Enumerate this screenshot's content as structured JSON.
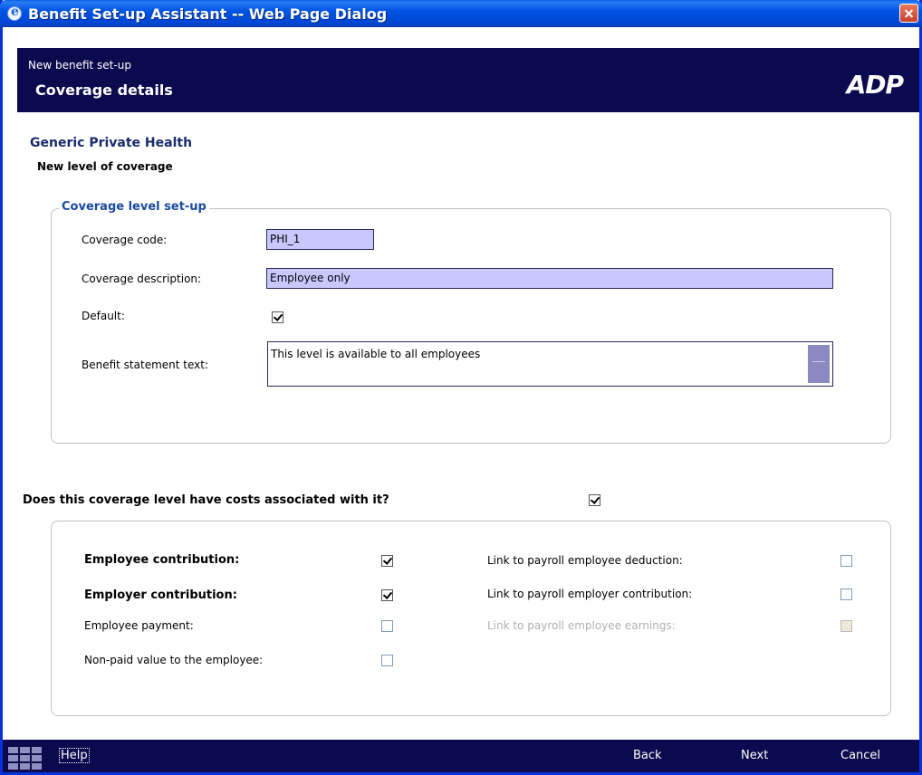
{
  "window": {
    "title": "Benefit Set-up Assistant -- Web Page Dialog"
  },
  "header": {
    "subtitle": "New benefit set-up",
    "title": "Coverage details",
    "logo": "ADP"
  },
  "benefit": {
    "name": "Generic Private Health",
    "subheading": "New level of coverage"
  },
  "setup": {
    "legend": "Coverage level set-up",
    "code_label": "Coverage code:",
    "code_value": "PHI_1",
    "description_label": "Coverage description:",
    "description_value": "Employee only",
    "default_label": "Default:",
    "default_checked": true,
    "statement_label": "Benefit statement text:",
    "statement_value": "This level is available to all employees"
  },
  "costs": {
    "question": "Does this coverage level have costs associated with it?",
    "question_checked": true,
    "left": [
      {
        "label": "Employee contribution:",
        "checked": true
      },
      {
        "label": "Employer contribution:",
        "checked": true
      },
      {
        "label": "Employee payment:",
        "checked": false
      },
      {
        "label": "Non-paid value to the employee:",
        "checked": false
      }
    ],
    "right": [
      {
        "label": "Link to payroll employee deduction:",
        "checked": false,
        "disabled": false
      },
      {
        "label": "Link to payroll employer contribution:",
        "checked": false,
        "disabled": false
      },
      {
        "label": "Link to payroll employee earnings:",
        "checked": false,
        "disabled": true
      }
    ]
  },
  "footer": {
    "help": "Help",
    "back": "Back",
    "next": "Next",
    "cancel": "Cancel"
  }
}
